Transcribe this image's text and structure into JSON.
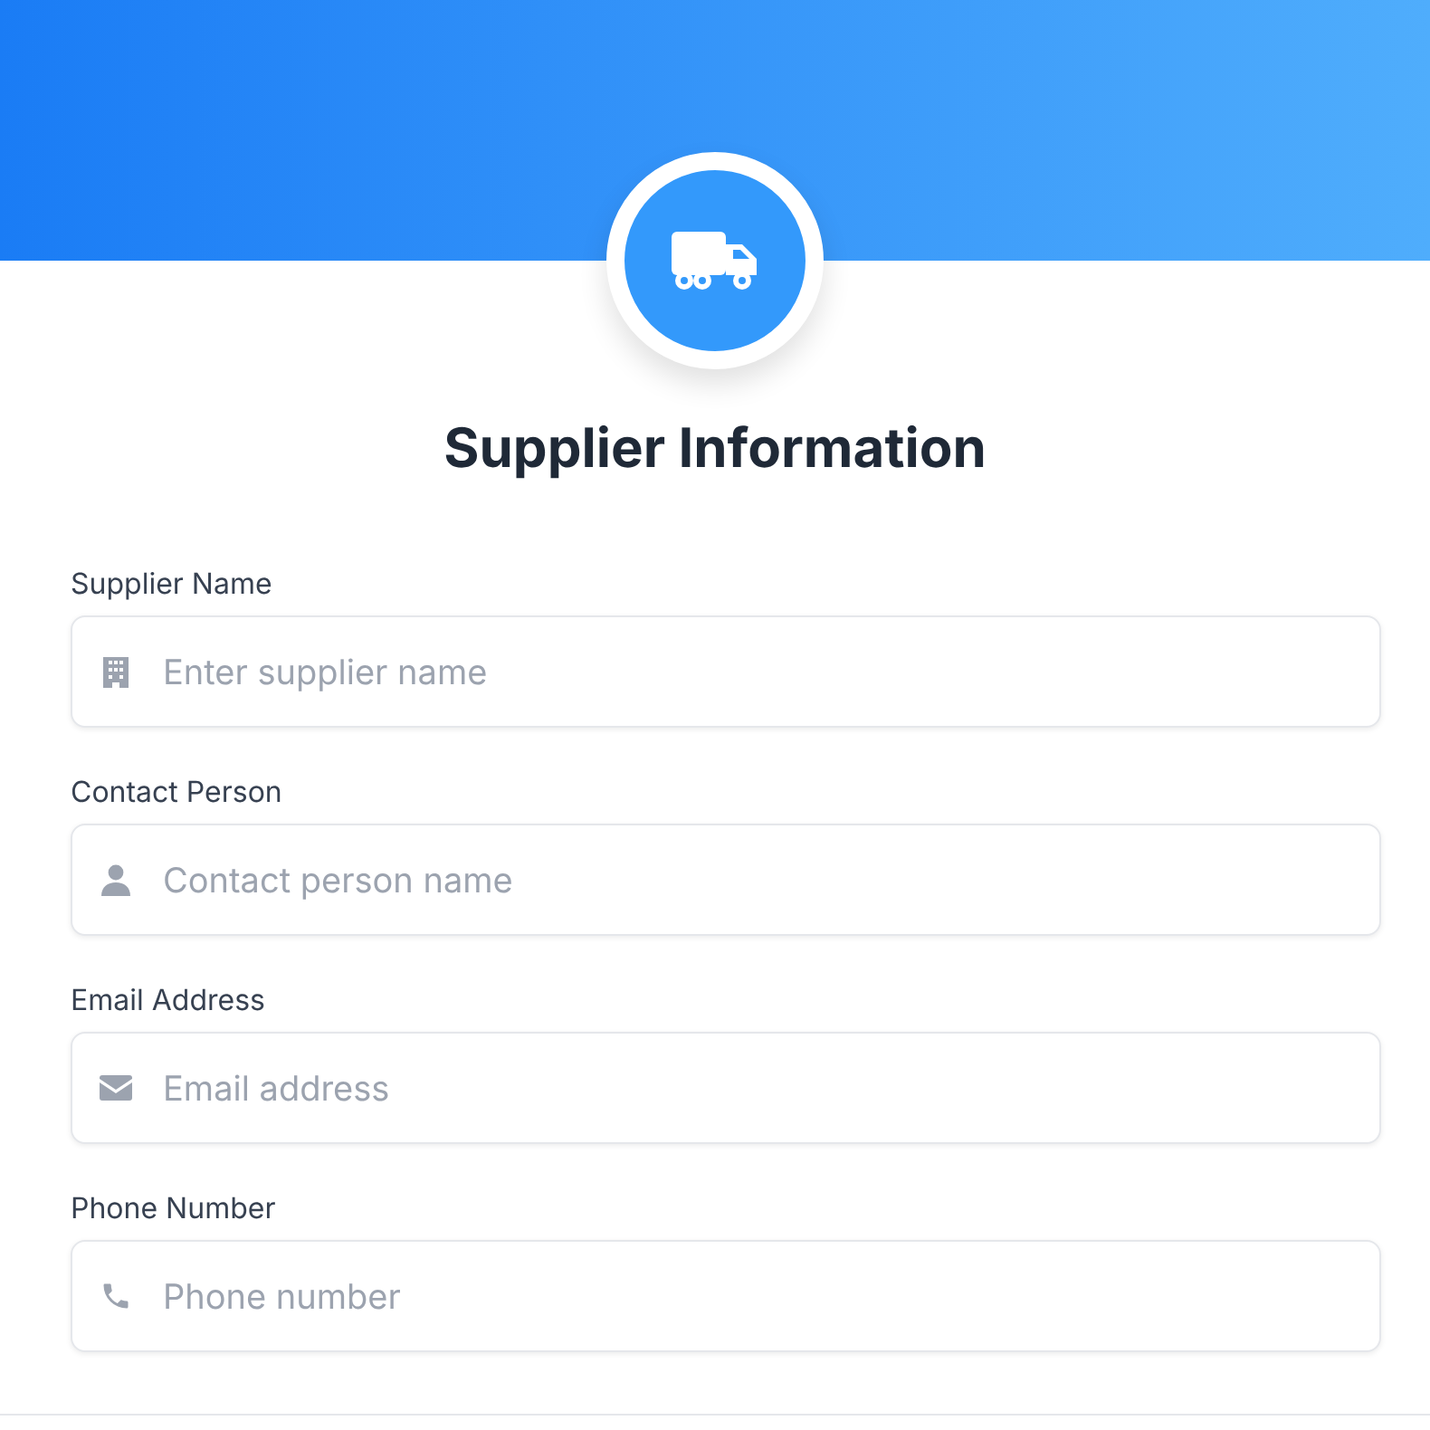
{
  "title": "Supplier Information",
  "fields": [
    {
      "label": "Supplier Name",
      "placeholder": "Enter supplier name",
      "kind": "building"
    },
    {
      "label": "Contact Person",
      "placeholder": "Contact person name",
      "kind": "person"
    },
    {
      "label": "Email Address",
      "placeholder": "Email address",
      "kind": "email"
    },
    {
      "label": "Phone Number",
      "placeholder": "Phone number",
      "kind": "phone"
    }
  ]
}
